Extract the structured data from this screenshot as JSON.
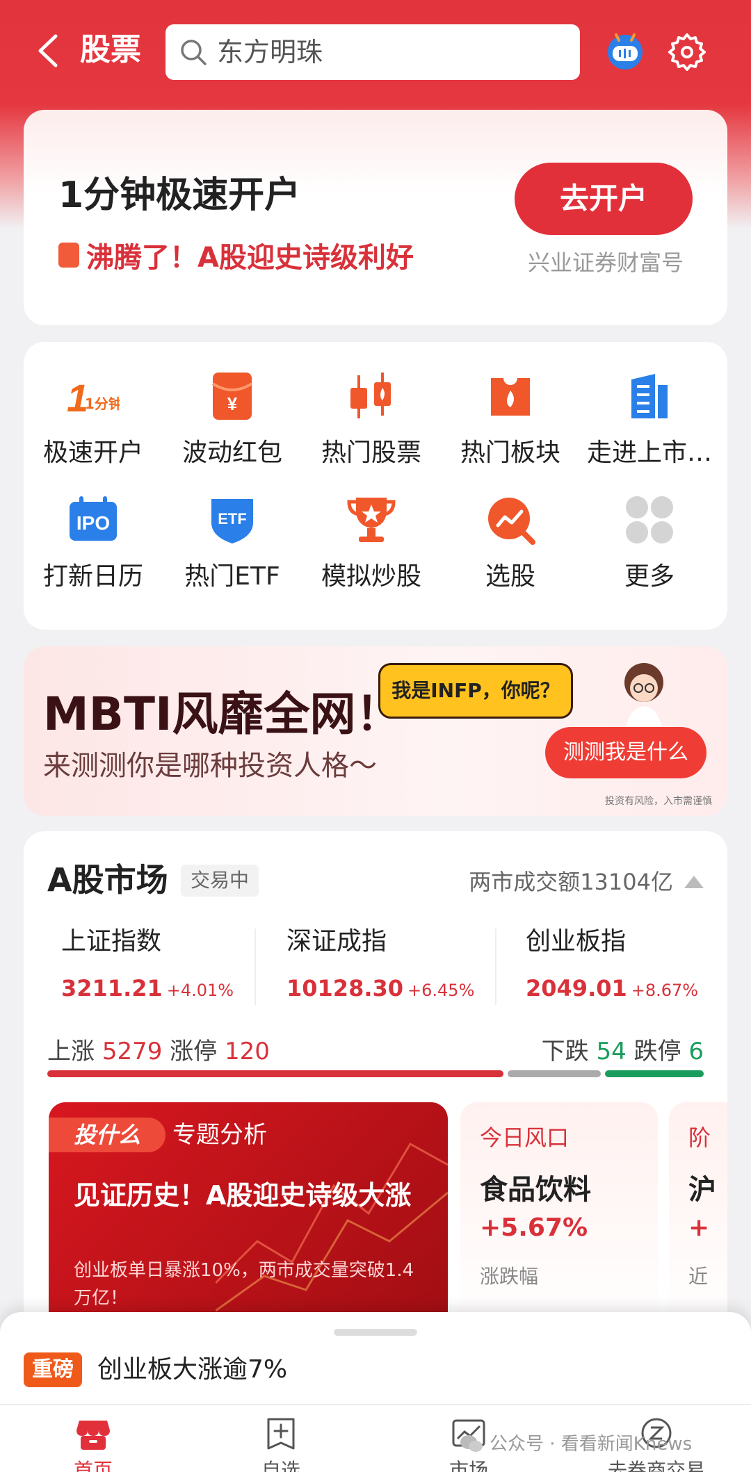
{
  "header": {
    "title": "股票",
    "search_text": "东方明珠"
  },
  "promo_open": {
    "title": "1分钟极速开户",
    "subtitle": "沸腾了！A股迎史诗级利好",
    "button": "去开户",
    "caption": "兴业证券财富号"
  },
  "shortcuts": [
    {
      "label": "极速开户",
      "icon": "fast-account-icon"
    },
    {
      "label": "波动红包",
      "icon": "red-envelope-icon"
    },
    {
      "label": "热门股票",
      "icon": "hot-stock-icon"
    },
    {
      "label": "热门板块",
      "icon": "hot-sector-icon"
    },
    {
      "label": "走进上市…",
      "icon": "building-icon"
    },
    {
      "label": "打新日历",
      "icon": "ipo-calendar-icon"
    },
    {
      "label": "热门ETF",
      "icon": "etf-shield-icon"
    },
    {
      "label": "模拟炒股",
      "icon": "trophy-icon"
    },
    {
      "label": "选股",
      "icon": "stock-picker-icon"
    },
    {
      "label": "更多",
      "icon": "more-grid-icon"
    }
  ],
  "icon_text": {
    "one_min": "1分钟",
    "ipo": "IPO",
    "etf": "ETF",
    "yen": "¥"
  },
  "mbti": {
    "headline": "MBTI风靡全网！",
    "sub": "来测测你是哪种投资人格～",
    "bubble": "我是INFP，你呢？",
    "button": "测测我是什么",
    "risk": "投资有风险，入市需谨慎"
  },
  "market": {
    "title": "A股市场",
    "status": "交易中",
    "volume": "两市成交额13104亿",
    "indices": [
      {
        "name": "上证指数",
        "value": "3211.21",
        "change": "+4.01%"
      },
      {
        "name": "深证成指",
        "value": "10128.30",
        "change": "+6.45%"
      },
      {
        "name": "创业板指",
        "value": "2049.01",
        "change": "+8.67%"
      }
    ],
    "up_label": "上涨",
    "up_count": "5279",
    "limit_up_label": "涨停",
    "limit_up_count": "120",
    "down_label": "下跌",
    "down_count": "54",
    "limit_down_label": "跌停",
    "limit_down_count": "6",
    "breadth": {
      "up": 5279,
      "flat": 0,
      "down": 54
    },
    "colors": {
      "up": "#d9313a",
      "flat": "#aaaaaa",
      "down": "#1a9d5c"
    }
  },
  "feature": {
    "tag": "投什么",
    "tag_title": "专题分析",
    "headline": "见证历史！A股迎史诗级大涨",
    "desc": "创业板单日暴涨10%，两市成交量突破1.4万亿！"
  },
  "tile1": {
    "title": "今日风口",
    "name": "食品饮料",
    "change": "+5.67%",
    "foot": "涨跌幅"
  },
  "tile2": {
    "title": "阶",
    "name": "沪",
    "change": "+",
    "foot": "近"
  },
  "news": {
    "badge": "重磅",
    "text": "创业板大涨逾7%"
  },
  "tabs": [
    {
      "label": "首页"
    },
    {
      "label": "自选"
    },
    {
      "label": "市场"
    },
    {
      "label": "去券商交易"
    }
  ],
  "watermark": "公众号 · 看看新闻Knews"
}
